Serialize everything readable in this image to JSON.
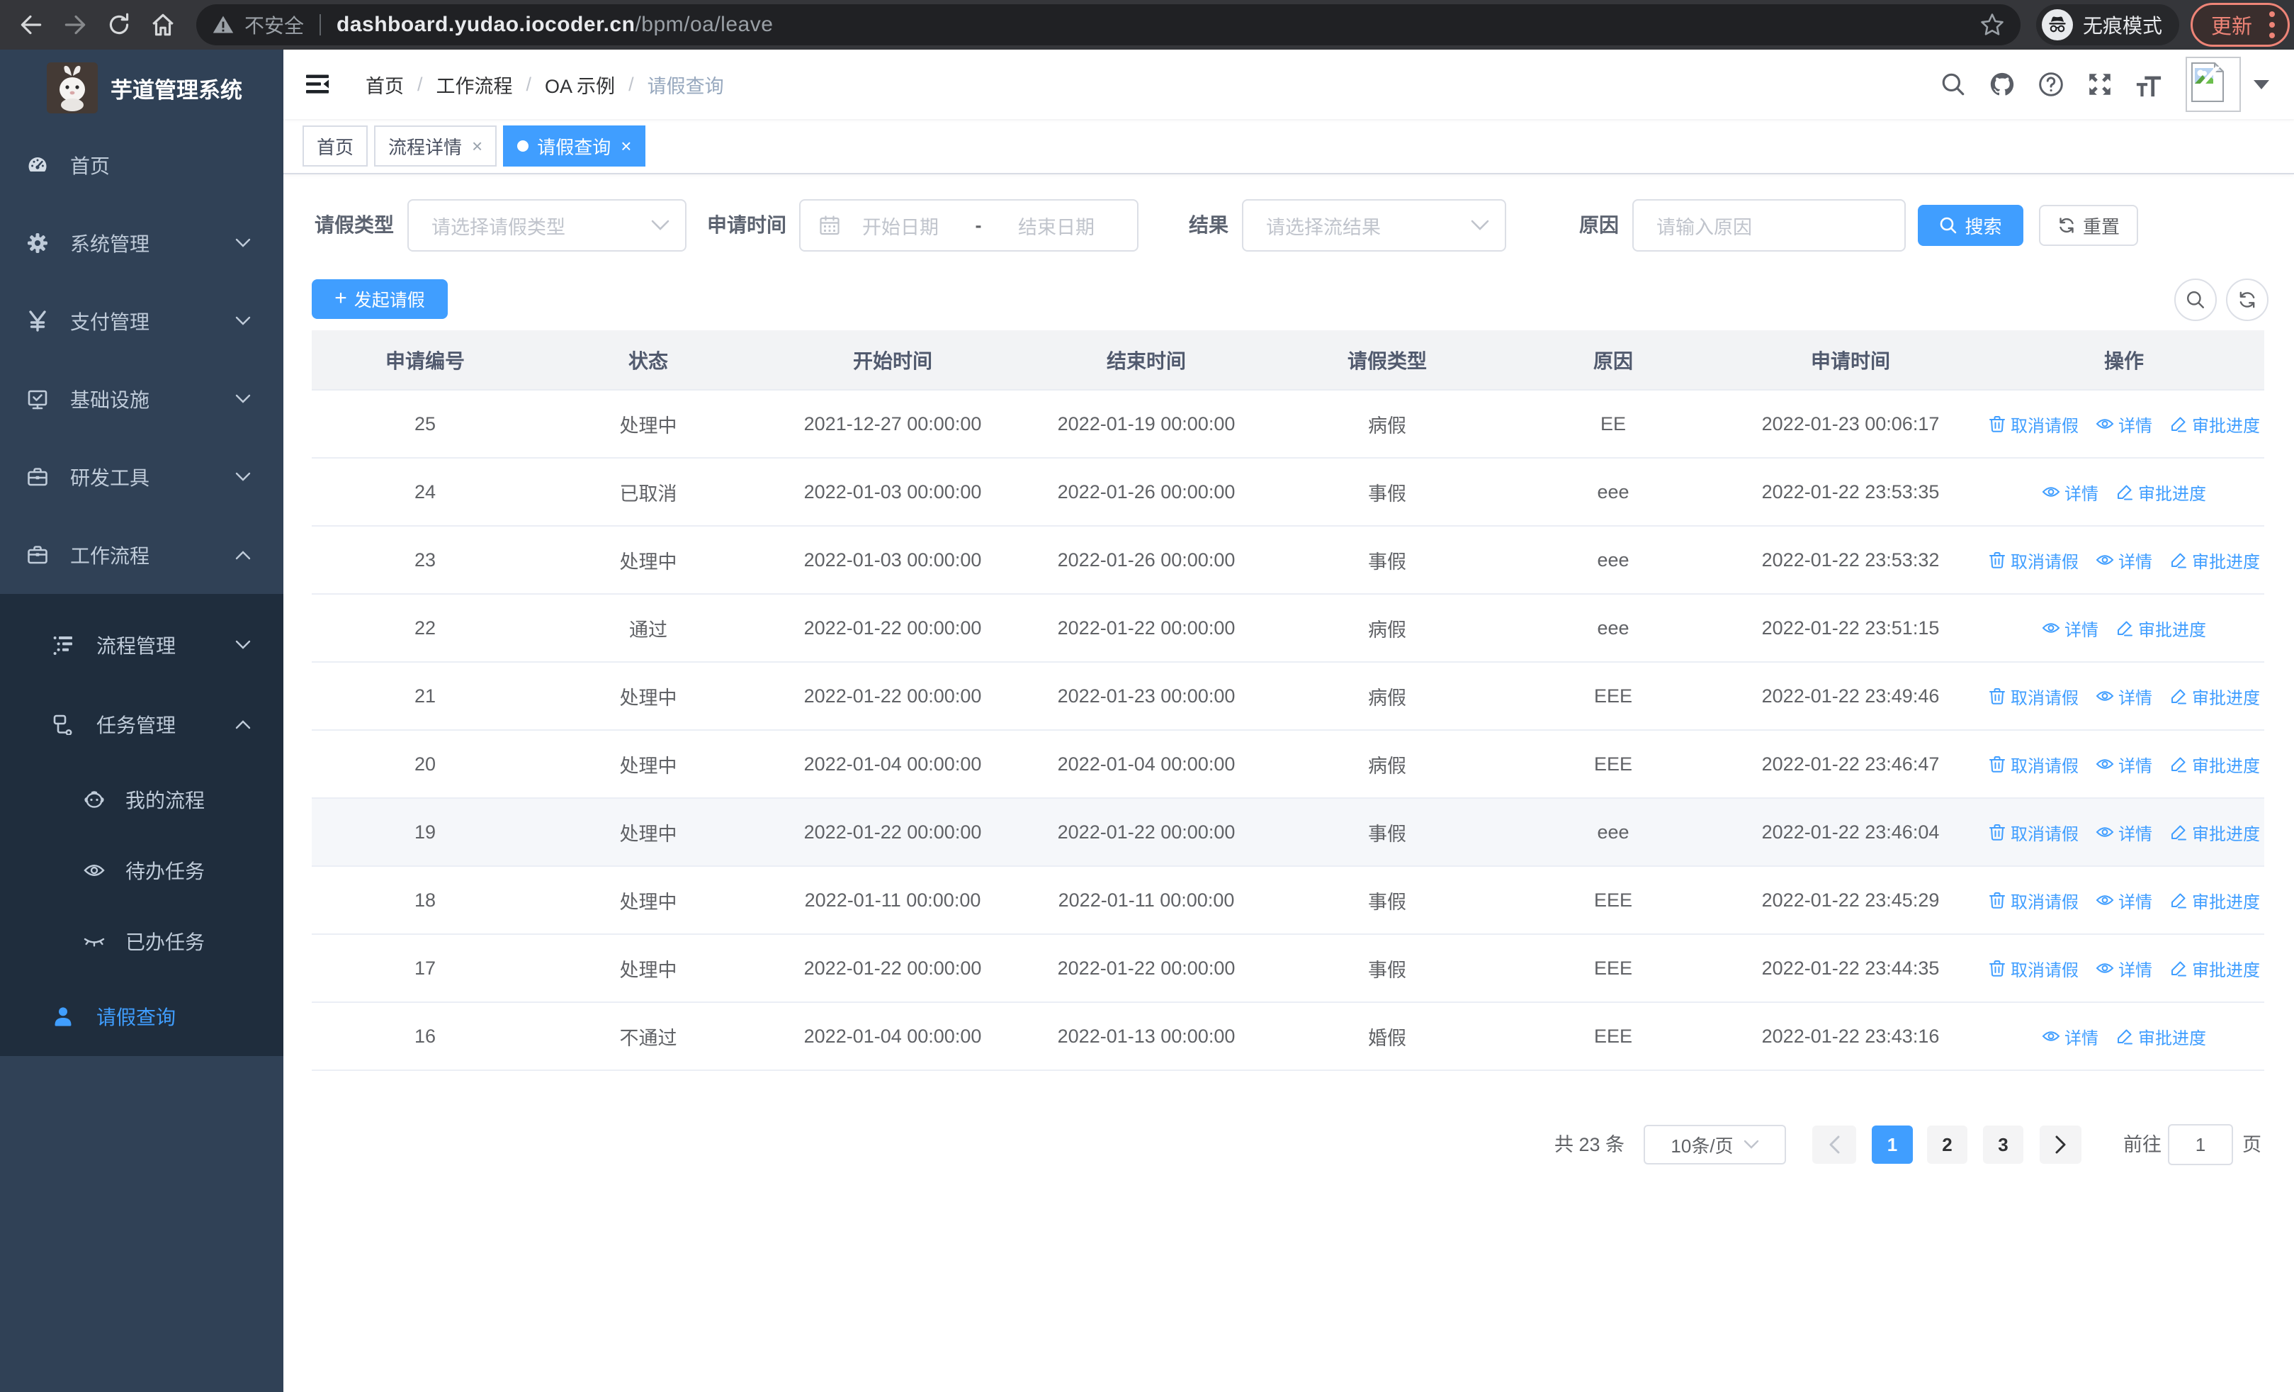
{
  "browser": {
    "security_label": "不安全",
    "url_host": "dashboard.yudao.iocoder.cn",
    "url_path": "/bpm/oa/leave",
    "incognito_label": "无痕模式",
    "update_label": "更新",
    "icons": [
      "back-arrow",
      "forward-arrow",
      "reload",
      "home",
      "warning-triangle",
      "bookmark-star",
      "incognito",
      "kebab-menu"
    ]
  },
  "sidebar": {
    "title": "芋道管理系统",
    "logo_icon": "rabbit-avatar",
    "items": [
      {
        "label": "首页",
        "icon": "dashboard-icon",
        "level": 0,
        "arrow": "none",
        "active": false
      },
      {
        "label": "系统管理",
        "icon": "gear-icon",
        "level": 0,
        "arrow": "down",
        "active": false
      },
      {
        "label": "支付管理",
        "icon": "yen-icon",
        "level": 0,
        "arrow": "down",
        "active": false
      },
      {
        "label": "基础设施",
        "icon": "board-check-icon",
        "level": 0,
        "arrow": "down",
        "active": false
      },
      {
        "label": "研发工具",
        "icon": "briefcase-icon",
        "level": 0,
        "arrow": "down",
        "active": false
      },
      {
        "label": "工作流程",
        "icon": "briefcase-icon",
        "level": 0,
        "arrow": "up",
        "active": false
      },
      {
        "label": "流程管理",
        "icon": "tree-list-icon",
        "level": 1,
        "arrow": "down",
        "active": false
      },
      {
        "label": "任务管理",
        "icon": "branch-icon",
        "level": 1,
        "arrow": "up",
        "active": false
      },
      {
        "label": "我的流程",
        "icon": "robot-icon",
        "level": 2,
        "arrow": "none",
        "active": false
      },
      {
        "label": "待办任务",
        "icon": "eye-open-icon",
        "level": 2,
        "arrow": "none",
        "active": false
      },
      {
        "label": "已办任务",
        "icon": "eye-closed-icon",
        "level": 2,
        "arrow": "none",
        "active": false
      },
      {
        "label": "请假查询",
        "icon": "user-icon",
        "level": 1,
        "arrow": "none",
        "active": true
      }
    ]
  },
  "navbar": {
    "breadcrumb": [
      "首页",
      "工作流程",
      "OA 示例",
      "请假查询"
    ],
    "separator": "/",
    "icons": [
      "search-icon",
      "github-icon",
      "help-icon",
      "fullscreen-icon",
      "font-size-icon",
      "avatar-broken-image",
      "caret-down"
    ]
  },
  "tabs": [
    {
      "label": "首页",
      "closable": false,
      "active": false
    },
    {
      "label": "流程详情",
      "closable": true,
      "active": false
    },
    {
      "label": "请假查询",
      "closable": true,
      "active": true
    }
  ],
  "tab_close_glyph": "×",
  "filters": {
    "leave_type": {
      "label": "请假类型",
      "placeholder": "请选择请假类型"
    },
    "apply_time": {
      "label": "申请时间",
      "start_placeholder": "开始日期",
      "separator": "-",
      "end_placeholder": "结束日期"
    },
    "result": {
      "label": "结果",
      "placeholder": "请选择流结果"
    },
    "reason": {
      "label": "原因",
      "placeholder": "请输入原因"
    },
    "search_label": "搜索",
    "reset_label": "重置"
  },
  "toolbar": {
    "create_label": "发起请假",
    "plus_glyph": "+",
    "right_icons": [
      "search-circle-icon",
      "refresh-circle-icon"
    ]
  },
  "table": {
    "columns": [
      "申请编号",
      "状态",
      "开始时间",
      "结束时间",
      "请假类型",
      "原因",
      "申请时间",
      "操作"
    ],
    "action_labels": {
      "cancel": "取消请假",
      "detail": "详情",
      "progress": "审批进度"
    },
    "action_icons": {
      "cancel": "trash-icon",
      "detail": "eye-icon",
      "progress": "pencil-icon"
    },
    "rows": [
      {
        "id": "25",
        "status": "处理中",
        "start": "2021-12-27 00:00:00",
        "end": "2022-01-19 00:00:00",
        "type": "病假",
        "reason": "EE",
        "applied": "2022-01-23 00:06:17",
        "actions": [
          "cancel",
          "detail",
          "progress"
        ],
        "highlighted": false
      },
      {
        "id": "24",
        "status": "已取消",
        "start": "2022-01-03 00:00:00",
        "end": "2022-01-26 00:00:00",
        "type": "事假",
        "reason": "eee",
        "applied": "2022-01-22 23:53:35",
        "actions": [
          "detail",
          "progress"
        ],
        "highlighted": false
      },
      {
        "id": "23",
        "status": "处理中",
        "start": "2022-01-03 00:00:00",
        "end": "2022-01-26 00:00:00",
        "type": "事假",
        "reason": "eee",
        "applied": "2022-01-22 23:53:32",
        "actions": [
          "cancel",
          "detail",
          "progress"
        ],
        "highlighted": false
      },
      {
        "id": "22",
        "status": "通过",
        "start": "2022-01-22 00:00:00",
        "end": "2022-01-22 00:00:00",
        "type": "病假",
        "reason": "eee",
        "applied": "2022-01-22 23:51:15",
        "actions": [
          "detail",
          "progress"
        ],
        "highlighted": false
      },
      {
        "id": "21",
        "status": "处理中",
        "start": "2022-01-22 00:00:00",
        "end": "2022-01-23 00:00:00",
        "type": "病假",
        "reason": "EEE",
        "applied": "2022-01-22 23:49:46",
        "actions": [
          "cancel",
          "detail",
          "progress"
        ],
        "highlighted": false
      },
      {
        "id": "20",
        "status": "处理中",
        "start": "2022-01-04 00:00:00",
        "end": "2022-01-04 00:00:00",
        "type": "病假",
        "reason": "EEE",
        "applied": "2022-01-22 23:46:47",
        "actions": [
          "cancel",
          "detail",
          "progress"
        ],
        "highlighted": false
      },
      {
        "id": "19",
        "status": "处理中",
        "start": "2022-01-22 00:00:00",
        "end": "2022-01-22 00:00:00",
        "type": "事假",
        "reason": "eee",
        "applied": "2022-01-22 23:46:04",
        "actions": [
          "cancel",
          "detail",
          "progress"
        ],
        "highlighted": true
      },
      {
        "id": "18",
        "status": "处理中",
        "start": "2022-01-11 00:00:00",
        "end": "2022-01-11 00:00:00",
        "type": "事假",
        "reason": "EEE",
        "applied": "2022-01-22 23:45:29",
        "actions": [
          "cancel",
          "detail",
          "progress"
        ],
        "highlighted": false
      },
      {
        "id": "17",
        "status": "处理中",
        "start": "2022-01-22 00:00:00",
        "end": "2022-01-22 00:00:00",
        "type": "事假",
        "reason": "EEE",
        "applied": "2022-01-22 23:44:35",
        "actions": [
          "cancel",
          "detail",
          "progress"
        ],
        "highlighted": false
      },
      {
        "id": "16",
        "status": "不通过",
        "start": "2022-01-04 00:00:00",
        "end": "2022-01-13 00:00:00",
        "type": "婚假",
        "reason": "EEE",
        "applied": "2022-01-22 23:43:16",
        "actions": [
          "detail",
          "progress"
        ],
        "highlighted": false
      }
    ]
  },
  "pagination": {
    "total_label": "共 23 条",
    "page_size_label": "10条/页",
    "pages": [
      "1",
      "2",
      "3"
    ],
    "active_page": "1",
    "goto_label": "前往",
    "goto_value": "1",
    "goto_suffix": "页"
  },
  "colors": {
    "accent": "#409eff",
    "sidebar_bg": "#304156",
    "submenu_bg": "#1f2d3d",
    "sidebar_text": "#bfcbd9",
    "update_chip": "#ee8477",
    "table_header_bg": "#f2f3f5",
    "row_highlight": "#f5f7fa"
  }
}
